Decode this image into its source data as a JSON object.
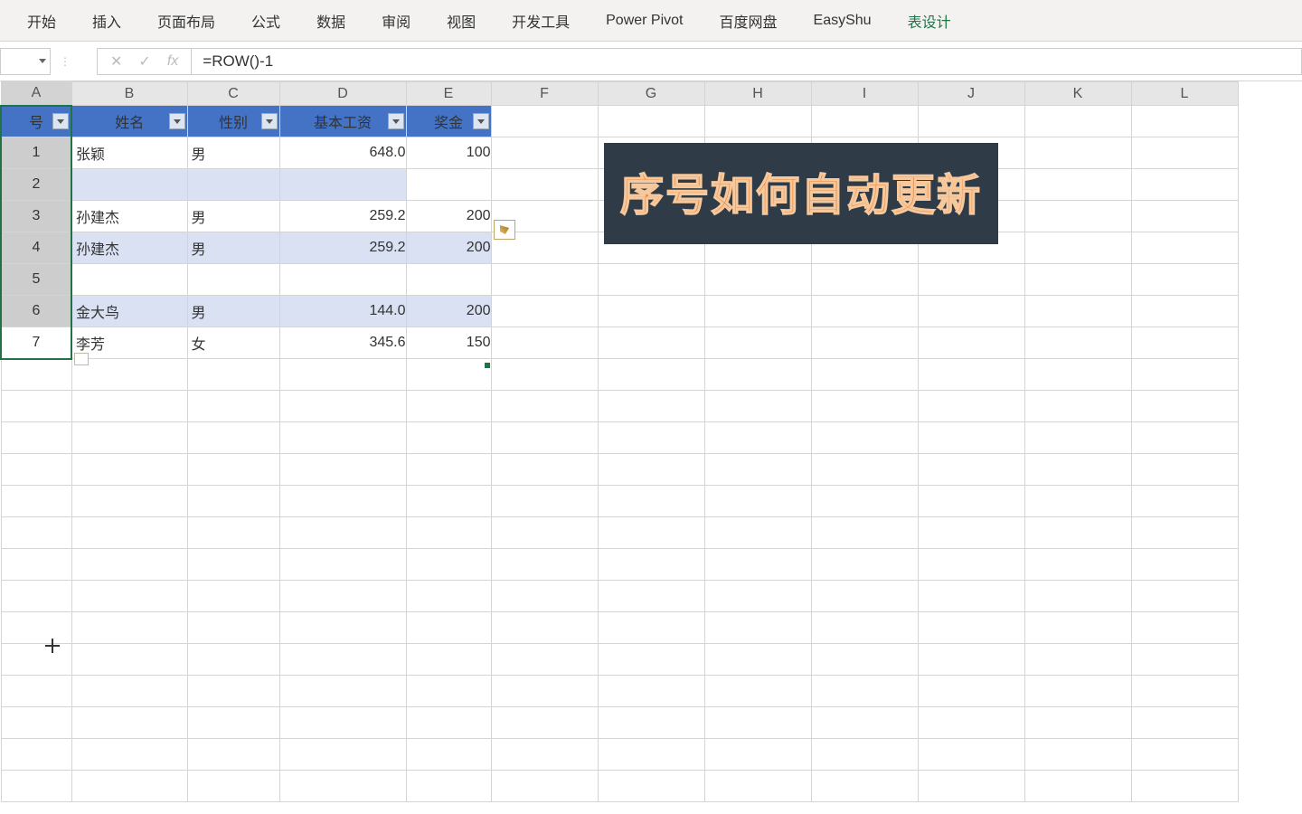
{
  "ribbon": {
    "tabs": [
      "开始",
      "插入",
      "页面布局",
      "公式",
      "数据",
      "审阅",
      "视图",
      "开发工具",
      "Power Pivot",
      "百度网盘",
      "EasyShu",
      "表设计"
    ],
    "active_index": 11
  },
  "formula_bar": {
    "name_box_value": "",
    "cancel": "✕",
    "confirm": "✓",
    "fx": "fx",
    "formula": "=ROW()-1"
  },
  "columns": [
    "A",
    "B",
    "C",
    "D",
    "E",
    "F",
    "G",
    "H",
    "I",
    "J",
    "K",
    "L"
  ],
  "table": {
    "headers": [
      "号",
      "姓名",
      "性别",
      "基本工资",
      "奖金"
    ],
    "rows": [
      {
        "seq": "1",
        "name": "张颖",
        "gender": "男",
        "salary": "648.0",
        "bonus": "100"
      },
      {
        "seq": "2",
        "name": "",
        "gender": "",
        "salary": "",
        "bonus": ""
      },
      {
        "seq": "3",
        "name": "孙建杰",
        "gender": "男",
        "salary": "259.2",
        "bonus": "200"
      },
      {
        "seq": "4",
        "name": "孙建杰",
        "gender": "男",
        "salary": "259.2",
        "bonus": "200"
      },
      {
        "seq": "5",
        "name": "",
        "gender": "",
        "salary": "",
        "bonus": ""
      },
      {
        "seq": "6",
        "name": "金大鸟",
        "gender": "男",
        "salary": "144.0",
        "bonus": "200"
      },
      {
        "seq": "7",
        "name": "李芳",
        "gender": "女",
        "salary": "345.6",
        "bonus": "150"
      }
    ]
  },
  "overlay": {
    "text": "序号如何自动更新"
  }
}
